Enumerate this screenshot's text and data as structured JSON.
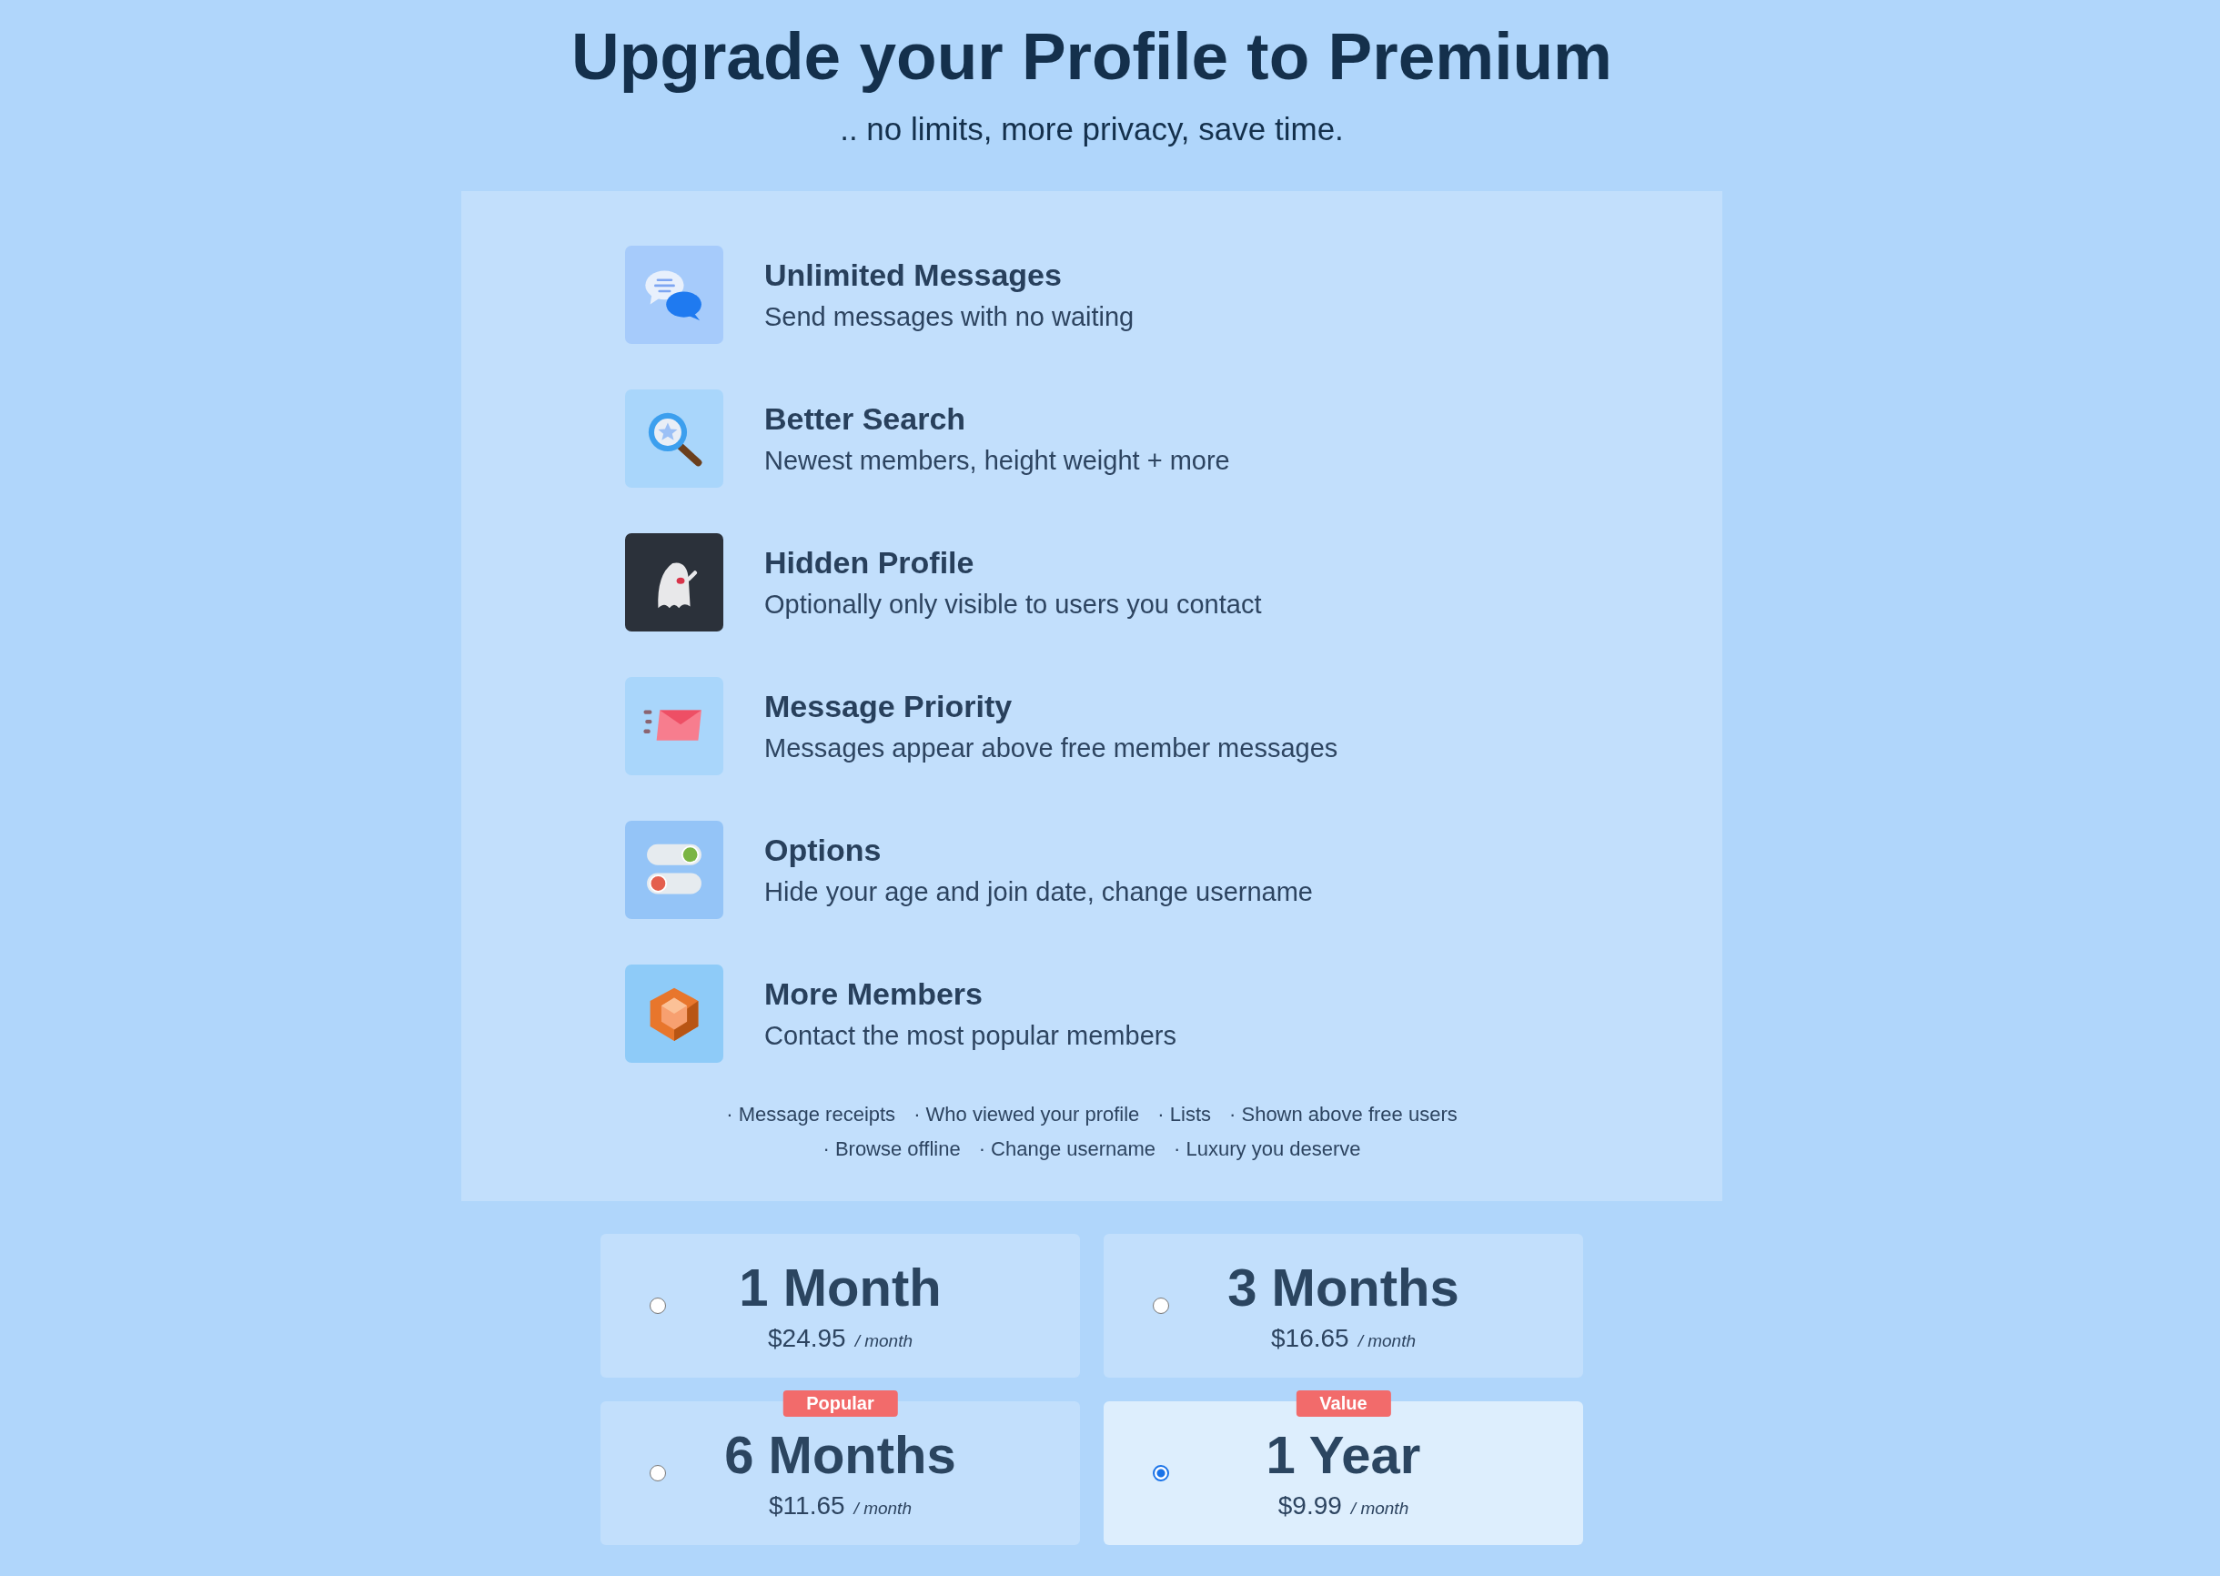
{
  "header": {
    "title": "Upgrade your Profile to Premium",
    "subtitle": ".. no limits, more privacy, save time."
  },
  "features": [
    {
      "kind": "chat",
      "title": "Unlimited Messages",
      "description": "Send messages with no waiting"
    },
    {
      "kind": "search",
      "title": "Better Search",
      "description": "Newest members, height weight + more"
    },
    {
      "kind": "ghost",
      "title": "Hidden Profile",
      "description": "Optionally only visible to users you contact"
    },
    {
      "kind": "envelope",
      "title": "Message Priority",
      "description": "Messages appear above free member messages"
    },
    {
      "kind": "toggles",
      "title": "Options",
      "description": "Hide your age and join date, change username"
    },
    {
      "kind": "gem",
      "title": "More Members",
      "description": "Contact the most popular members"
    }
  ],
  "extras": [
    [
      "· Message receipts",
      "· Who viewed your profile",
      "· Lists",
      "· Shown above free users"
    ],
    [
      "· Browse offline",
      "· Change username",
      "· Luxury you deserve"
    ]
  ],
  "plans": [
    {
      "name": "1 Month",
      "price": "$24.95",
      "unit": "/ month",
      "selected": false
    },
    {
      "name": "3 Months",
      "price": "$16.65",
      "unit": "/ month",
      "selected": false
    },
    {
      "name": "6 Months",
      "price": "$11.65",
      "unit": "/ month",
      "selected": false,
      "badge": "Popular"
    },
    {
      "name": "1 Year",
      "price": "$9.99",
      "unit": "/ month",
      "selected": true,
      "badge": "Value"
    }
  ]
}
